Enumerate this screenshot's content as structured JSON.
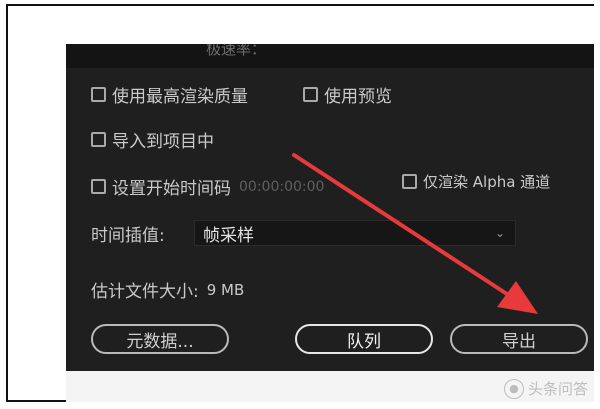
{
  "dialog": {
    "partial_top_text": "极速率：",
    "checkboxes": {
      "max_render_quality": {
        "label": "使用最高渲染质量",
        "checked": false
      },
      "use_previews": {
        "label": "使用预览",
        "checked": false
      },
      "import_into_project": {
        "label": "导入到项目中",
        "checked": false
      },
      "set_start_timecode": {
        "label": "设置开始时间码",
        "checked": false,
        "timecode": "00:00:00:00"
      },
      "render_alpha_only": {
        "label": "仅渲染 Alpha 通道",
        "checked": false
      }
    },
    "time_interpolation": {
      "label": "时间插值:",
      "selected": "帧采样"
    },
    "estimated_file_size": {
      "label": "估计文件大小:",
      "value": "9 MB"
    },
    "buttons": {
      "metadata": "元数据...",
      "queue": "队列",
      "export": "导出"
    },
    "annotation_color": "#e83a3a"
  },
  "watermark": {
    "text": "头条问答"
  }
}
